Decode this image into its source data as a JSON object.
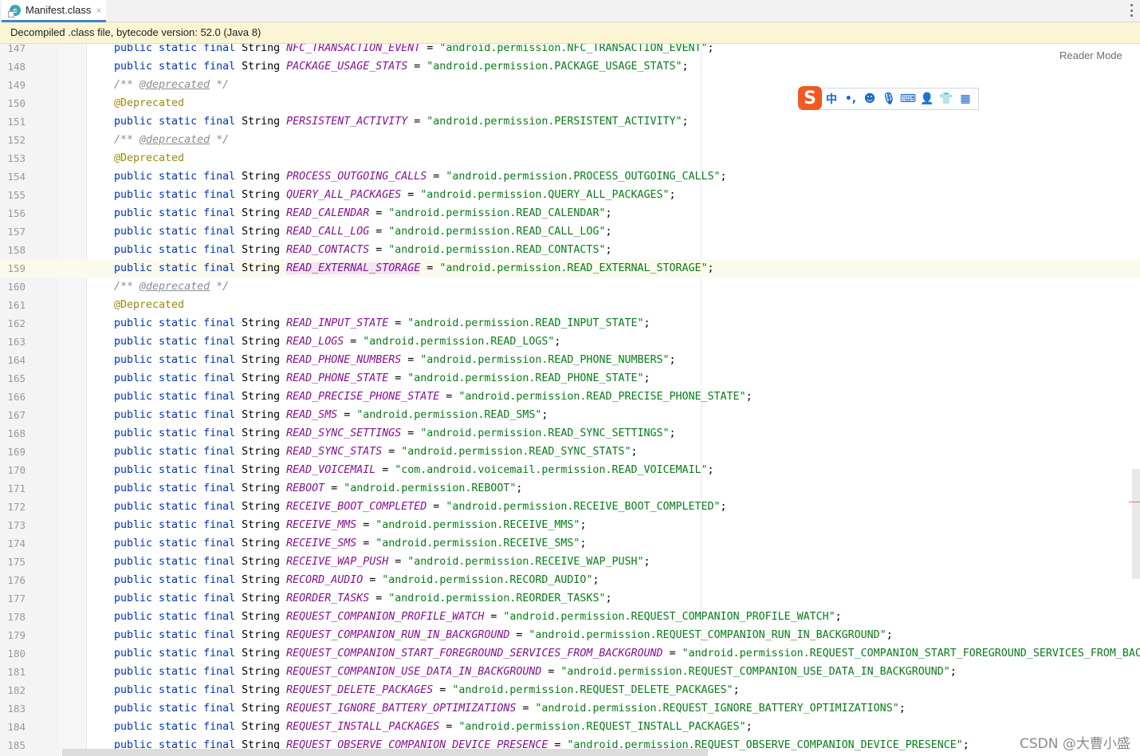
{
  "tab": {
    "title": "Manifest.class",
    "close_glyph": "×",
    "file_icon": "class-file-icon"
  },
  "banner": {
    "text": "Decompiled .class file, bytecode version: 52.0 (Java 8)"
  },
  "reader_mode": "Reader Mode",
  "ime_toolbar": {
    "logo": "S",
    "items": [
      {
        "name": "chinese-mode-icon",
        "glyph": "中"
      },
      {
        "name": "punctuation-icon",
        "glyph": "•,"
      },
      {
        "name": "emoji-icon",
        "glyph": "☻"
      },
      {
        "name": "microphone-icon",
        "glyph": "🎙"
      },
      {
        "name": "keyboard-icon",
        "glyph": "⌨"
      },
      {
        "name": "user-icon",
        "glyph": "👤"
      },
      {
        "name": "skin-icon",
        "glyph": "👕"
      },
      {
        "name": "toolbox-icon",
        "glyph": "▦"
      }
    ]
  },
  "watermark": "CSDN @大曹小盛",
  "current_line": 159,
  "colors": {
    "keyword": "#0033b3",
    "field": "#871094",
    "string": "#067d17",
    "comment": "#8c8c8c",
    "annotation": "#9e880d",
    "banner_bg": "#fcf5d4",
    "tab_underline": "#4083c9"
  },
  "code_lines": [
    {
      "no": "147",
      "type": "field",
      "name": "NFC_TRANSACTION_EVENT",
      "value": "\"android.permission.NFC_TRANSACTION_EVENT\""
    },
    {
      "no": "148",
      "type": "field",
      "name": "PACKAGE_USAGE_STATS",
      "value": "\"android.permission.PACKAGE_USAGE_STATS\""
    },
    {
      "no": "149",
      "type": "doc",
      "pre": "/** ",
      "tag": "@deprecated",
      "post": " */"
    },
    {
      "no": "150",
      "type": "annotation",
      "text": "@Deprecated"
    },
    {
      "no": "151",
      "type": "field",
      "name": "PERSISTENT_ACTIVITY",
      "value": "\"android.permission.PERSISTENT_ACTIVITY\""
    },
    {
      "no": "152",
      "type": "doc",
      "pre": "/** ",
      "tag": "@deprecated",
      "post": " */"
    },
    {
      "no": "153",
      "type": "annotation",
      "text": "@Deprecated"
    },
    {
      "no": "154",
      "type": "field",
      "name": "PROCESS_OUTGOING_CALLS",
      "value": "\"android.permission.PROCESS_OUTGOING_CALLS\""
    },
    {
      "no": "155",
      "type": "field",
      "name": "QUERY_ALL_PACKAGES",
      "value": "\"android.permission.QUERY_ALL_PACKAGES\""
    },
    {
      "no": "156",
      "type": "field",
      "name": "READ_CALENDAR",
      "value": "\"android.permission.READ_CALENDAR\""
    },
    {
      "no": "157",
      "type": "field",
      "name": "READ_CALL_LOG",
      "value": "\"android.permission.READ_CALL_LOG\""
    },
    {
      "no": "158",
      "type": "field",
      "name": "READ_CONTACTS",
      "value": "\"android.permission.READ_CONTACTS\""
    },
    {
      "no": "159",
      "type": "field",
      "name": "READ_EXTERNAL_STORAGE",
      "value": "\"android.permission.READ_EXTERNAL_STORAGE\"",
      "highlight": true
    },
    {
      "no": "160",
      "type": "doc",
      "pre": "/** ",
      "tag": "@deprecated",
      "post": " */"
    },
    {
      "no": "161",
      "type": "annotation",
      "text": "@Deprecated"
    },
    {
      "no": "162",
      "type": "field",
      "name": "READ_INPUT_STATE",
      "value": "\"android.permission.READ_INPUT_STATE\""
    },
    {
      "no": "163",
      "type": "field",
      "name": "READ_LOGS",
      "value": "\"android.permission.READ_LOGS\""
    },
    {
      "no": "164",
      "type": "field",
      "name": "READ_PHONE_NUMBERS",
      "value": "\"android.permission.READ_PHONE_NUMBERS\""
    },
    {
      "no": "165",
      "type": "field",
      "name": "READ_PHONE_STATE",
      "value": "\"android.permission.READ_PHONE_STATE\""
    },
    {
      "no": "166",
      "type": "field",
      "name": "READ_PRECISE_PHONE_STATE",
      "value": "\"android.permission.READ_PRECISE_PHONE_STATE\""
    },
    {
      "no": "167",
      "type": "field",
      "name": "READ_SMS",
      "value": "\"android.permission.READ_SMS\""
    },
    {
      "no": "168",
      "type": "field",
      "name": "READ_SYNC_SETTINGS",
      "value": "\"android.permission.READ_SYNC_SETTINGS\""
    },
    {
      "no": "169",
      "type": "field",
      "name": "READ_SYNC_STATS",
      "value": "\"android.permission.READ_SYNC_STATS\""
    },
    {
      "no": "170",
      "type": "field",
      "name": "READ_VOICEMAIL",
      "value": "\"com.android.voicemail.permission.READ_VOICEMAIL\""
    },
    {
      "no": "171",
      "type": "field",
      "name": "REBOOT",
      "value": "\"android.permission.REBOOT\""
    },
    {
      "no": "172",
      "type": "field",
      "name": "RECEIVE_BOOT_COMPLETED",
      "value": "\"android.permission.RECEIVE_BOOT_COMPLETED\""
    },
    {
      "no": "173",
      "type": "field",
      "name": "RECEIVE_MMS",
      "value": "\"android.permission.RECEIVE_MMS\""
    },
    {
      "no": "174",
      "type": "field",
      "name": "RECEIVE_SMS",
      "value": "\"android.permission.RECEIVE_SMS\""
    },
    {
      "no": "175",
      "type": "field",
      "name": "RECEIVE_WAP_PUSH",
      "value": "\"android.permission.RECEIVE_WAP_PUSH\""
    },
    {
      "no": "176",
      "type": "field",
      "name": "RECORD_AUDIO",
      "value": "\"android.permission.RECORD_AUDIO\""
    },
    {
      "no": "177",
      "type": "field",
      "name": "REORDER_TASKS",
      "value": "\"android.permission.REORDER_TASKS\""
    },
    {
      "no": "178",
      "type": "field",
      "name": "REQUEST_COMPANION_PROFILE_WATCH",
      "value": "\"android.permission.REQUEST_COMPANION_PROFILE_WATCH\""
    },
    {
      "no": "179",
      "type": "field",
      "name": "REQUEST_COMPANION_RUN_IN_BACKGROUND",
      "value": "\"android.permission.REQUEST_COMPANION_RUN_IN_BACKGROUND\""
    },
    {
      "no": "180",
      "type": "field",
      "name": "REQUEST_COMPANION_START_FOREGROUND_SERVICES_FROM_BACKGROUND",
      "value": "\"android.permission.REQUEST_COMPANION_START_FOREGROUND_SERVICES_FROM_BAC"
    },
    {
      "no": "181",
      "type": "field",
      "name": "REQUEST_COMPANION_USE_DATA_IN_BACKGROUND",
      "value": "\"android.permission.REQUEST_COMPANION_USE_DATA_IN_BACKGROUND\""
    },
    {
      "no": "182",
      "type": "field",
      "name": "REQUEST_DELETE_PACKAGES",
      "value": "\"android.permission.REQUEST_DELETE_PACKAGES\""
    },
    {
      "no": "183",
      "type": "field",
      "name": "REQUEST_IGNORE_BATTERY_OPTIMIZATIONS",
      "value": "\"android.permission.REQUEST_IGNORE_BATTERY_OPTIMIZATIONS\""
    },
    {
      "no": "184",
      "type": "field",
      "name": "REQUEST_INSTALL_PACKAGES",
      "value": "\"android.permission.REQUEST_INSTALL_PACKAGES\""
    },
    {
      "no": "185",
      "type": "field",
      "name": "REQUEST_OBSERVE_COMPANION_DEVICE_PRESENCE",
      "value": "\"android.permission.REQUEST_OBSERVE_COMPANION_DEVICE_PRESENCE\""
    }
  ]
}
